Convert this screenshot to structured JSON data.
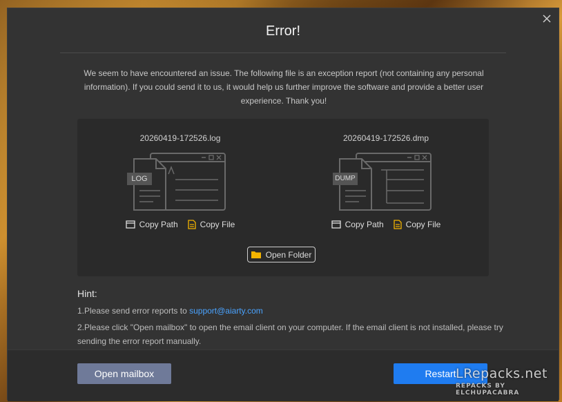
{
  "dialog": {
    "title": "Error!",
    "message": "We seem to have encountered an issue. The following file is an exception report (not containing any personal information). If you could send it to us, it would help us further improve the software and provide a better user experience. Thank you!"
  },
  "files": [
    {
      "name": "20260419-172526.log",
      "badge": "LOG",
      "copy_path": "Copy Path",
      "copy_file": "Copy File"
    },
    {
      "name": "20260419-172526.dmp",
      "badge": "DUMP",
      "copy_path": "Copy Path",
      "copy_file": "Copy File"
    }
  ],
  "open_folder_label": "Open Folder",
  "hint": {
    "title": "Hint:",
    "line1_prefix": "1.Please send error reports to ",
    "email": "support@aiarty.com",
    "line2": "2.Please click \"Open mailbox\" to open the email client on your computer. If the email client is not installed, please try sending the error report manually."
  },
  "footer": {
    "open_mailbox": "Open mailbox",
    "restart": "Restart"
  },
  "watermark": {
    "main": "LRepacks.net",
    "sub": "REPACKS BY ELCHUPACABRA"
  },
  "colors": {
    "dialog_bg": "#333333",
    "panel_bg": "#2a2a2a",
    "accent": "#1f7cf0",
    "link": "#4aa3ff",
    "folder_icon": "#f4b400",
    "file_icon": "#f4b400"
  }
}
